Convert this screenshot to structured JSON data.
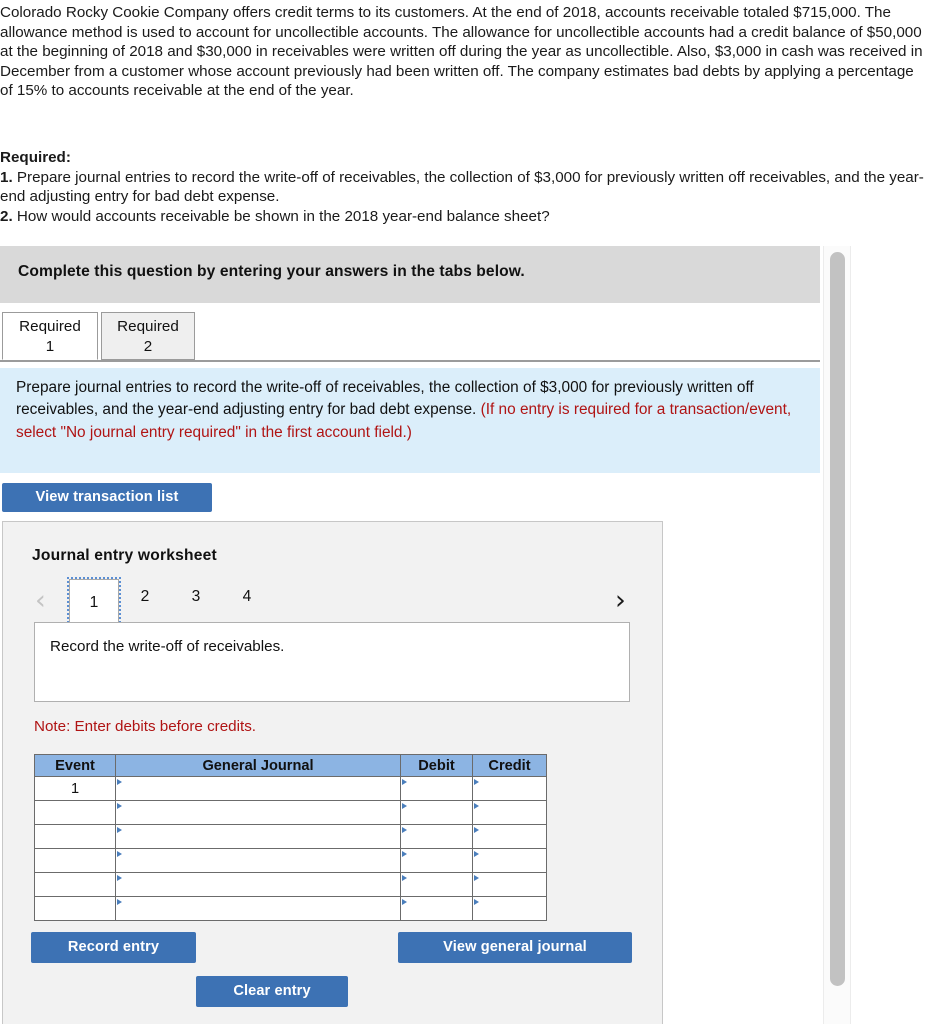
{
  "problem": {
    "paragraph": "Colorado Rocky Cookie Company offers credit terms to its customers. At the end of 2018, accounts receivable totaled $715,000. The allowance method is used to account for uncollectible accounts. The allowance for uncollectible accounts had a credit balance of $50,000 at the beginning of 2018 and $30,000 in receivables were written off during the year as uncollectible. Also, $3,000 in cash was received in December from a customer whose account previously had been written off. The company estimates bad debts by applying a percentage of 15% to accounts receivable at the end of the year."
  },
  "required": {
    "heading": "Required:",
    "item1_num": "1.",
    "item1_text": " Prepare journal entries to record the write-off of receivables, the collection of $3,000 for previously written off receivables, and the year-end adjusting entry for bad debt expense.",
    "item2_num": "2.",
    "item2_text": " How would accounts receivable be shown in the 2018 year-end balance sheet?"
  },
  "complete_bar": {
    "text": "Complete this question by entering your answers in the tabs below."
  },
  "tabs": [
    {
      "line1": "Required",
      "line2": "1",
      "active": true
    },
    {
      "line1": "Required",
      "line2": "2",
      "active": false
    }
  ],
  "instruction": {
    "black_text": "Prepare journal entries to record the write-off of receivables, the collection of $3,000 for previously written off receivables, and the year-end adjusting entry for bad debt expense. ",
    "red_text": "(If no entry is required for a transaction/event, select \"No journal entry required\" in the first account field.)"
  },
  "buttons": {
    "view_transaction_list": "View transaction list",
    "record_entry": "Record entry",
    "clear_entry": "Clear entry",
    "view_general_journal": "View general journal"
  },
  "worksheet": {
    "title": "Journal entry worksheet",
    "prev_icon": "‹",
    "next_icon": "›",
    "pages": [
      "1",
      "2",
      "3",
      "4"
    ],
    "active_page": "1",
    "description": "Record the write-off of receivables.",
    "note": "Note: Enter debits before credits."
  },
  "journal_table": {
    "headers": [
      "Event",
      "General Journal",
      "Debit",
      "Credit"
    ],
    "rows": [
      {
        "event": "1",
        "general_journal": "",
        "debit": "",
        "credit": ""
      },
      {
        "event": "",
        "general_journal": "",
        "debit": "",
        "credit": ""
      },
      {
        "event": "",
        "general_journal": "",
        "debit": "",
        "credit": ""
      },
      {
        "event": "",
        "general_journal": "",
        "debit": "",
        "credit": ""
      },
      {
        "event": "",
        "general_journal": "",
        "debit": "",
        "credit": ""
      },
      {
        "event": "",
        "general_journal": "",
        "debit": "",
        "credit": ""
      }
    ]
  },
  "colors": {
    "button_blue": "#3d72b4",
    "header_blue": "#8cb4e3",
    "instruction_bg": "#dbeefa",
    "complete_bar_bg": "#d9d9d9",
    "red_text": "#b01414",
    "panel_bg": "#f2f2f2"
  }
}
